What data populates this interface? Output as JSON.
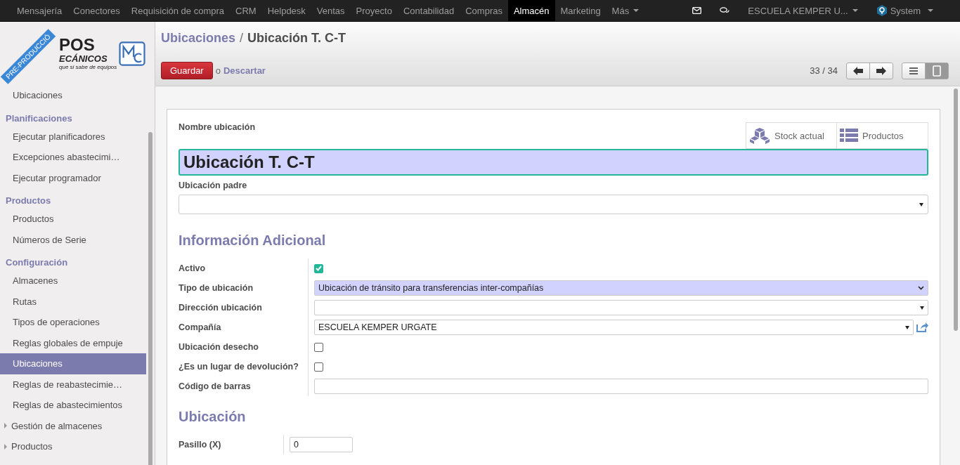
{
  "topbar": {
    "menu": [
      {
        "label": "Mensajería",
        "selected": false
      },
      {
        "label": "Conectores",
        "selected": false
      },
      {
        "label": "Requisición de compra",
        "selected": false
      },
      {
        "label": "CRM",
        "selected": false
      },
      {
        "label": "Helpdesk",
        "selected": false
      },
      {
        "label": "Ventas",
        "selected": false
      },
      {
        "label": "Proyecto",
        "selected": false
      },
      {
        "label": "Contabilidad",
        "selected": false
      },
      {
        "label": "Compras",
        "selected": false
      },
      {
        "label": "Almacén",
        "selected": true
      },
      {
        "label": "Marketing",
        "selected": false
      }
    ],
    "more": "Más",
    "company": "ESCUELA KEMPER U...",
    "user": "System"
  },
  "logo": {
    "line1": "POS",
    "line2": "ECÁNICOS",
    "tagline": "que si sabe de equipos",
    "ribbon": "PRE-PRODUCCIÓ"
  },
  "sidebar": {
    "items": [
      {
        "kind": "item",
        "label": "Ubicaciones",
        "selected": false
      },
      {
        "kind": "header",
        "label": "Planificaciones"
      },
      {
        "kind": "item",
        "label": "Ejecutar planificadores",
        "selected": false
      },
      {
        "kind": "item",
        "label": "Excepciones abastecimi…",
        "selected": false
      },
      {
        "kind": "item",
        "label": "Ejecutar programador",
        "selected": false
      },
      {
        "kind": "header",
        "label": "Productos"
      },
      {
        "kind": "item",
        "label": "Productos",
        "selected": false
      },
      {
        "kind": "item",
        "label": "Números de Serie",
        "selected": false
      },
      {
        "kind": "header",
        "label": "Configuración"
      },
      {
        "kind": "item",
        "label": "Almacenes",
        "selected": false
      },
      {
        "kind": "item",
        "label": "Rutas",
        "selected": false
      },
      {
        "kind": "item",
        "label": "Tipos de operaciones",
        "selected": false
      },
      {
        "kind": "item",
        "label": "Reglas globales de empuje",
        "selected": false
      },
      {
        "kind": "item",
        "label": "Ubicaciones",
        "selected": true
      },
      {
        "kind": "item",
        "label": "Reglas de reabastecimie…",
        "selected": false
      },
      {
        "kind": "item",
        "label": "Reglas de abastecimientos",
        "selected": false
      },
      {
        "kind": "folder",
        "label": "Gestión de almacenes",
        "expanded": false
      },
      {
        "kind": "folder",
        "label": "Productos",
        "expanded": false
      }
    ]
  },
  "breadcrumb": {
    "parent": "Ubicaciones",
    "separator": "/",
    "current": "Ubicación T. C-T"
  },
  "actions": {
    "save": "Guardar",
    "or": "o",
    "discard": "Descartar"
  },
  "pager": "33 / 34",
  "form": {
    "name_label": "Nombre ubicación",
    "name": "Ubicación T. C-T",
    "smart_buttons": [
      {
        "kind": "cubes",
        "label": "Stock actual"
      },
      {
        "kind": "list",
        "label": "Productos"
      }
    ],
    "parent_label": "Ubicación padre",
    "section1": "Información Adicional",
    "fields": [
      {
        "kind": "checkbox",
        "label": "Activo",
        "checked": true
      },
      {
        "kind": "select",
        "label": "Tipo de ubicación",
        "value": "Ubicación de tránsito para transferencias inter-compañías",
        "required": true
      },
      {
        "kind": "many2one",
        "label": "Dirección ubicación"
      },
      {
        "kind": "many2one",
        "label": "Compañía",
        "value": "ESCUELA KEMPER URGATE",
        "external": true
      },
      {
        "kind": "checkbox",
        "label": "Ubicación desecho",
        "checked": false
      },
      {
        "kind": "checkbox",
        "label": "¿Es un lugar de devolución?",
        "checked": false
      },
      {
        "kind": "text",
        "label": "Código de barras"
      }
    ],
    "section2": "Ubicación",
    "pasillo_label": "Pasillo (X)",
    "pasillo": "0"
  }
}
